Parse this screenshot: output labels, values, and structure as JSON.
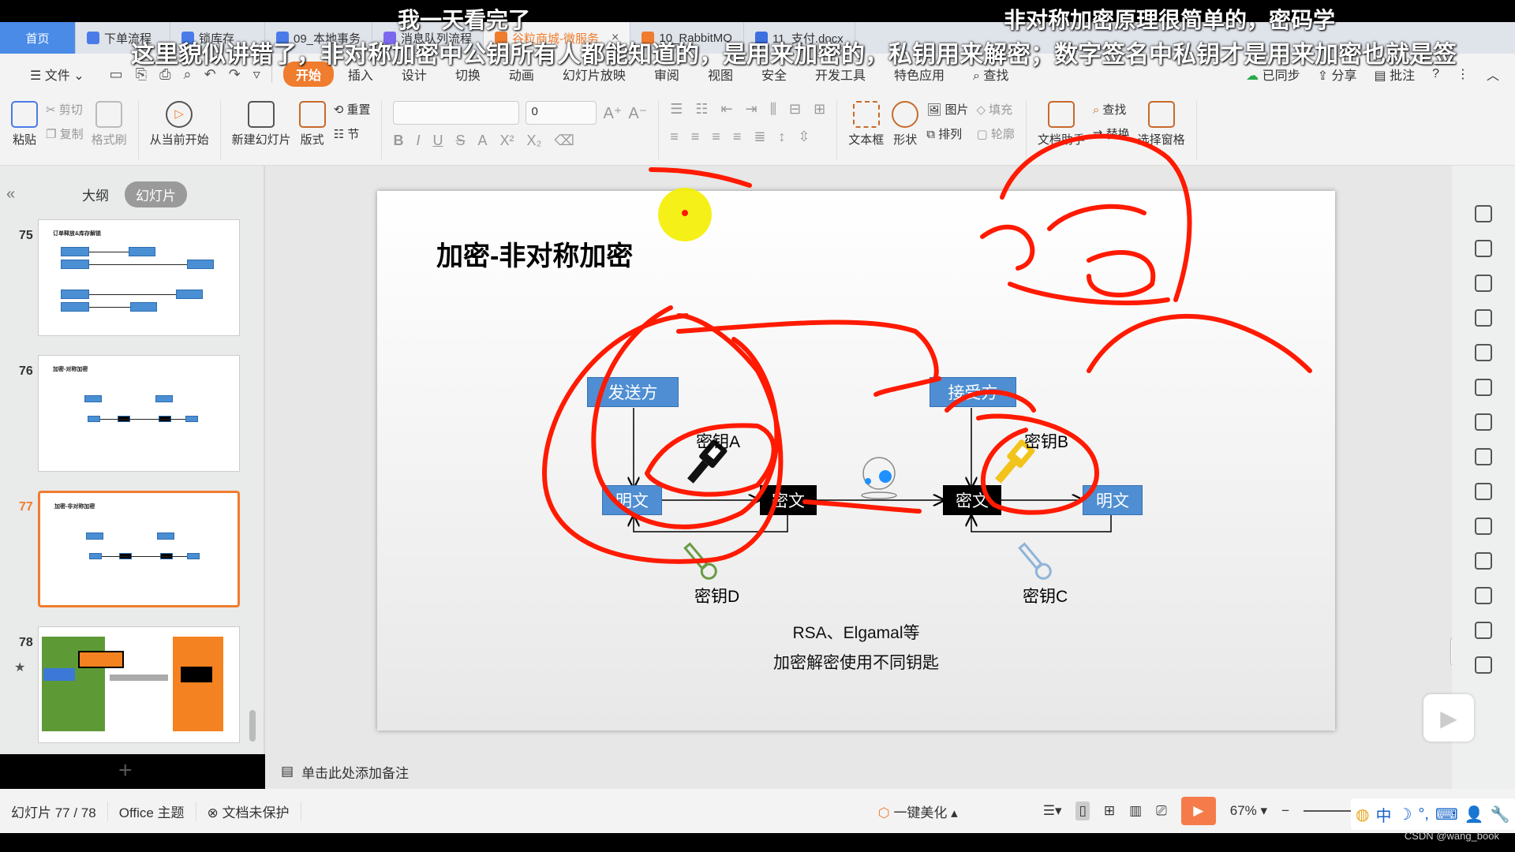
{
  "window": {
    "tabs": [
      {
        "label": "首页",
        "icon": "home",
        "active": false
      },
      {
        "label": "下单流程",
        "icon": "flow-icon",
        "color": "#4a7be8"
      },
      {
        "label": "锁库存",
        "icon": "flow-icon",
        "color": "#4a7be8"
      },
      {
        "label": "09_本地事务",
        "icon": "doc-icon",
        "color": "#4a7be8"
      },
      {
        "label": "消息队列流程",
        "icon": "flow-icon",
        "color": "#7b68ee"
      },
      {
        "label": "谷粒商城-微服务",
        "icon": "ppt-icon",
        "color": "#f07c2e",
        "active": true
      },
      {
        "label": "10_RabbitMQ",
        "icon": "ppt-icon",
        "color": "#f07c2e"
      },
      {
        "label": "11_支付.docx",
        "icon": "doc-icon",
        "color": "#3c6fe0"
      }
    ],
    "close_glyph": "×"
  },
  "menubar": {
    "file_label": "文件",
    "items": [
      "开始",
      "插入",
      "设计",
      "切换",
      "动画",
      "幻灯片放映",
      "审阅",
      "视图",
      "安全",
      "开发工具",
      "特色应用"
    ],
    "active_item": "开始",
    "search_label": "查找",
    "sync_label": "已同步",
    "share_label": "分享",
    "comment_label": "批注"
  },
  "ribbon": {
    "paste": "粘贴",
    "cut": "剪切",
    "copy": "复制",
    "format_painter": "格式刷",
    "from_current": "从当前开始",
    "new_slide": "新建幻灯片",
    "layout": "版式",
    "reset": "重置",
    "section": "节",
    "font_name": "",
    "font_size": "0",
    "textbox": "文本框",
    "shape": "形状",
    "picture": "图片",
    "arrange": "排列",
    "fill": "填充",
    "outline": "轮廓",
    "find": "查找",
    "replace": "替换",
    "doc_assistant": "文档助手",
    "select_pane": "选择窗格"
  },
  "left_panel": {
    "outline_tab": "大纲",
    "slides_tab": "幻灯片",
    "thumbnails": [
      {
        "number": "75",
        "title": "订单释放&库存解锁",
        "active": false
      },
      {
        "number": "76",
        "title": "加密-对称加密",
        "active": false
      },
      {
        "number": "77",
        "title": "加密-非对称加密",
        "active": true
      },
      {
        "number": "78",
        "title": "",
        "active": false
      }
    ],
    "add_slide_glyph": "+"
  },
  "slide": {
    "title": "加密-非对称加密",
    "sender": "发送方",
    "receiver": "接受方",
    "plaintext_left": "明文",
    "ciphertext_left": "密文",
    "ciphertext_right": "密文",
    "plaintext_right": "明文",
    "key_a": "密钥A",
    "key_b": "密钥B",
    "key_c": "密钥C",
    "key_d": "密钥D",
    "caption_line1": "RSA、Elgamal等",
    "caption_line2": "加密解密使用不同钥匙",
    "colors": {
      "box_blue": "#4f8ed2",
      "key_yellow": "#f2c31b",
      "key_green": "#6a9a44",
      "key_lightblue": "#8fb4d8",
      "annotation_red": "#ff1a00"
    }
  },
  "notes": {
    "placeholder": "单击此处添加备注"
  },
  "statusbar": {
    "slide_counter": "幻灯片 77 / 78",
    "theme": "Office 主题",
    "protection": "文档未保护",
    "beautify": "一键美化",
    "zoom": "67%"
  },
  "subtitles": {
    "line1_left": "我一天看完了",
    "line1_right": "非对称加密原理很简单的，密码学",
    "line2": "这里貌似讲错了，非对称加密中公钥所有人都能知道的，是用来加密的，私钥用来解密；数字签名中私钥才是用来加密也就是签"
  },
  "ime": {
    "label": "中"
  },
  "watermark": "CSDN @wang_book"
}
